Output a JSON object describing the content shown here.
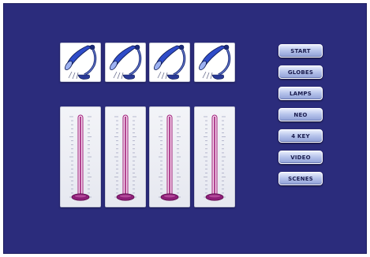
{
  "colors": {
    "background": "#2b2c7c",
    "panel": "#ffffff",
    "lamp_shade": "#2f4cc8",
    "fader_slot": "#a0207a",
    "fader_knob": "#8e1f78",
    "button_text": "#1a1c4e"
  },
  "channels": [
    {
      "lamp_icon": "desk-lamp-icon",
      "fader_level": 0.0
    },
    {
      "lamp_icon": "desk-lamp-icon",
      "fader_level": 0.0
    },
    {
      "lamp_icon": "desk-lamp-icon",
      "fader_level": 0.0
    },
    {
      "lamp_icon": "desk-lamp-icon",
      "fader_level": 0.0
    }
  ],
  "menu": {
    "items": [
      {
        "label": "START"
      },
      {
        "label": "GLOBES"
      },
      {
        "label": "LAMPS"
      },
      {
        "label": "NEO"
      },
      {
        "label": "4 KEY"
      },
      {
        "label": "VIDEO"
      },
      {
        "label": "SCENES"
      }
    ]
  }
}
